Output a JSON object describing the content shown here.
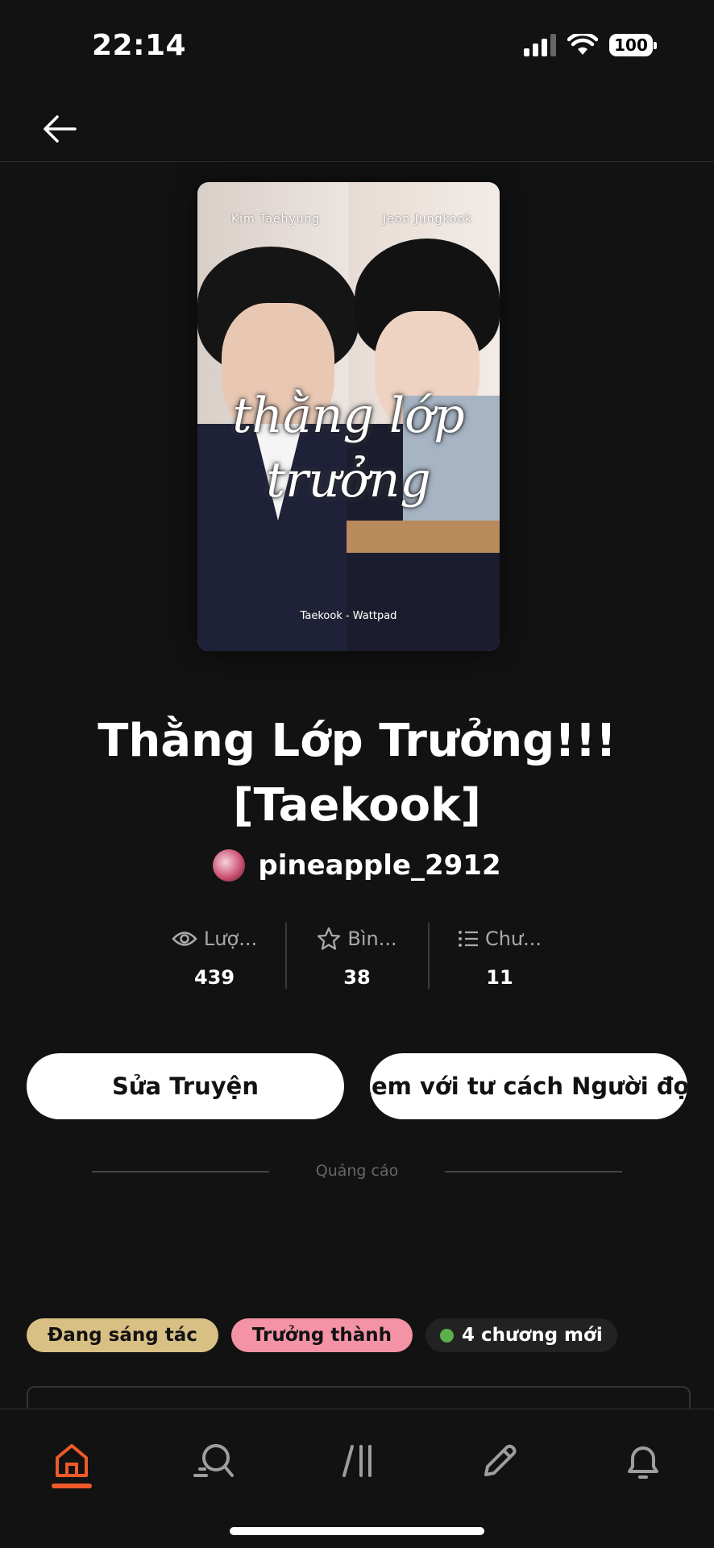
{
  "status_bar": {
    "time": "22:14",
    "battery": "100"
  },
  "cover": {
    "left_name": "Kim Taehyung",
    "right_name": "Jeon Jungkook",
    "script_line1": "thằng lớp",
    "script_line2": "trưởng",
    "credit": "Taekook - Wattpad"
  },
  "story": {
    "title_line1": "Thằng Lớp Trưởng!!!",
    "title_line2": "[Taekook]",
    "author": "pineapple_2912"
  },
  "stats": [
    {
      "label": "Lượ...",
      "value": "439",
      "icon": "eye-icon"
    },
    {
      "label": "Bìn...",
      "value": "38",
      "icon": "star-icon"
    },
    {
      "label": "Chư...",
      "value": "11",
      "icon": "list-icon"
    }
  ],
  "actions": {
    "edit_label": "Sửa Truyện",
    "reader_label": "Xem với tư cách Người đọc"
  },
  "ad_label": "Quảng cáo",
  "tags": {
    "status": "Đang sáng tác",
    "mature": "Trưởng thành",
    "new_chapters": "4 chương mới"
  },
  "nav": {
    "items": [
      "home-icon",
      "search-icon",
      "library-icon",
      "write-icon",
      "notification-icon"
    ],
    "active_index": 0
  },
  "colors": {
    "accent": "#ef5a2a",
    "background": "#121212",
    "tag_status": "#d8bf84",
    "tag_mature": "#f492a6",
    "new_dot": "#5cb04a"
  }
}
